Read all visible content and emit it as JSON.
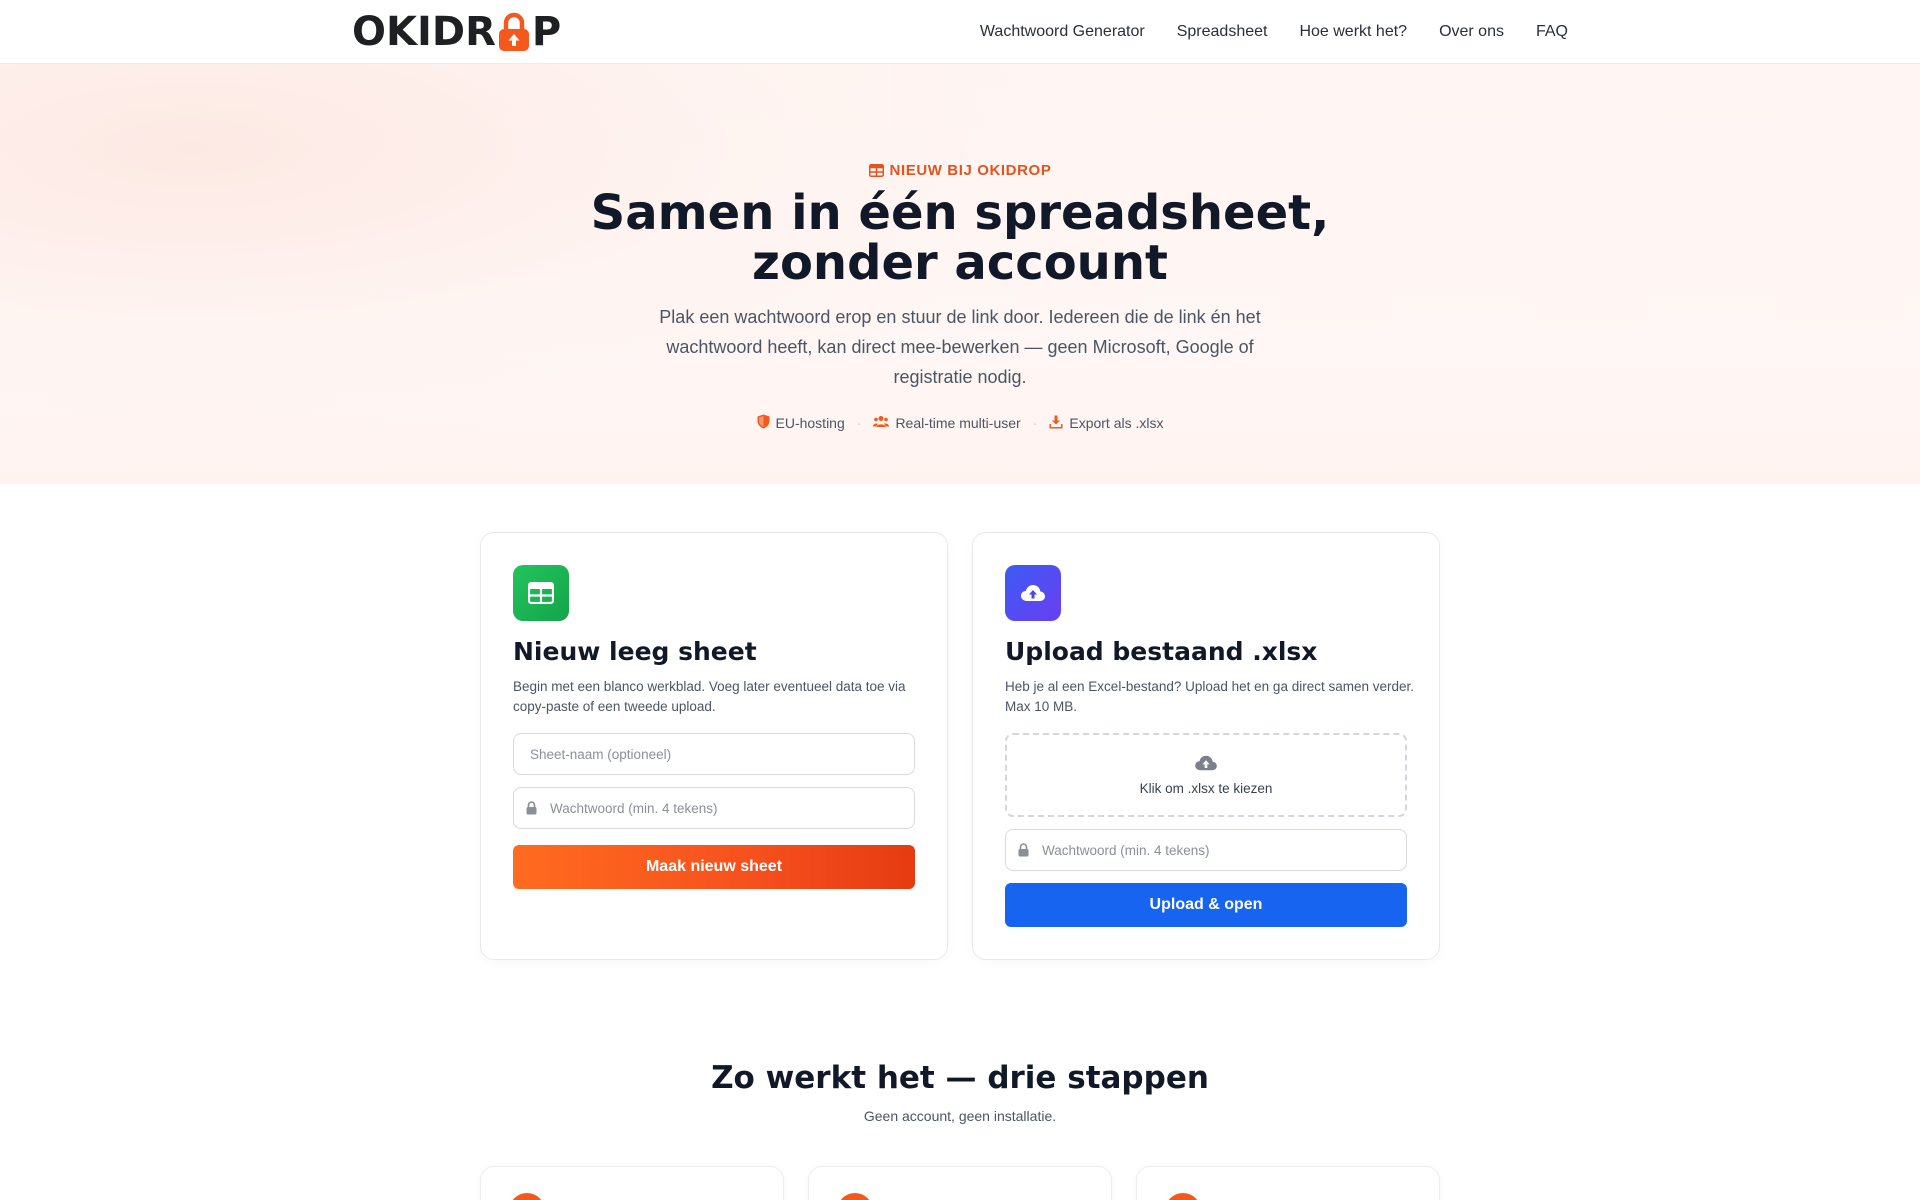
{
  "brand": {
    "logo_prefix": "OKIDR",
    "logo_suffix": "P",
    "accent": "#f4581d"
  },
  "nav": {
    "items": [
      {
        "label": "Wachtwoord Generator"
      },
      {
        "label": "Spreadsheet"
      },
      {
        "label": "Hoe werkt het?"
      },
      {
        "label": "Over ons"
      },
      {
        "label": "FAQ"
      }
    ]
  },
  "hero": {
    "badge": "NIEUW BIJ OKIDROP",
    "title_line1": "Samen in één spreadsheet,",
    "title_line2": "zonder account",
    "subtitle": "Plak een wachtwoord erop en stuur de link door. Iedereen die de link én het wachtwoord heeft, kan direct mee-bewerken — geen Microsoft, Google of registratie nodig.",
    "features": [
      {
        "label": "EU-hosting",
        "icon": "shield-icon"
      },
      {
        "label": "Real-time multi-user",
        "icon": "users-icon"
      },
      {
        "label": "Export als .xlsx",
        "icon": "download-icon"
      }
    ]
  },
  "new_sheet": {
    "title": "Nieuw leeg sheet",
    "description": "Begin met een blanco werkblad. Voeg later eventueel data toe via copy-paste of een tweede upload.",
    "name_placeholder": "Sheet-naam (optioneel)",
    "password_placeholder": "Wachtwoord (min. 4 tekens)",
    "button_label": "Maak nieuw sheet",
    "icon": "spreadsheet-icon",
    "icon_color": "#16a34a"
  },
  "upload": {
    "title": "Upload bestaand .xlsx",
    "description": "Heb je al een Excel-bestand? Upload het en ga direct samen verder. Max 10 MB.",
    "dropzone_label": "Klik om .xlsx te kiezen",
    "password_placeholder": "Wachtwoord (min. 4 tekens)",
    "button_label": "Upload & open",
    "icon": "cloud-upload-icon",
    "icon_color": "#4f46e5",
    "button_color": "#1764f0"
  },
  "steps": {
    "title": "Zo werkt het — drie stappen",
    "subtitle": "Geen account, geen installatie."
  }
}
